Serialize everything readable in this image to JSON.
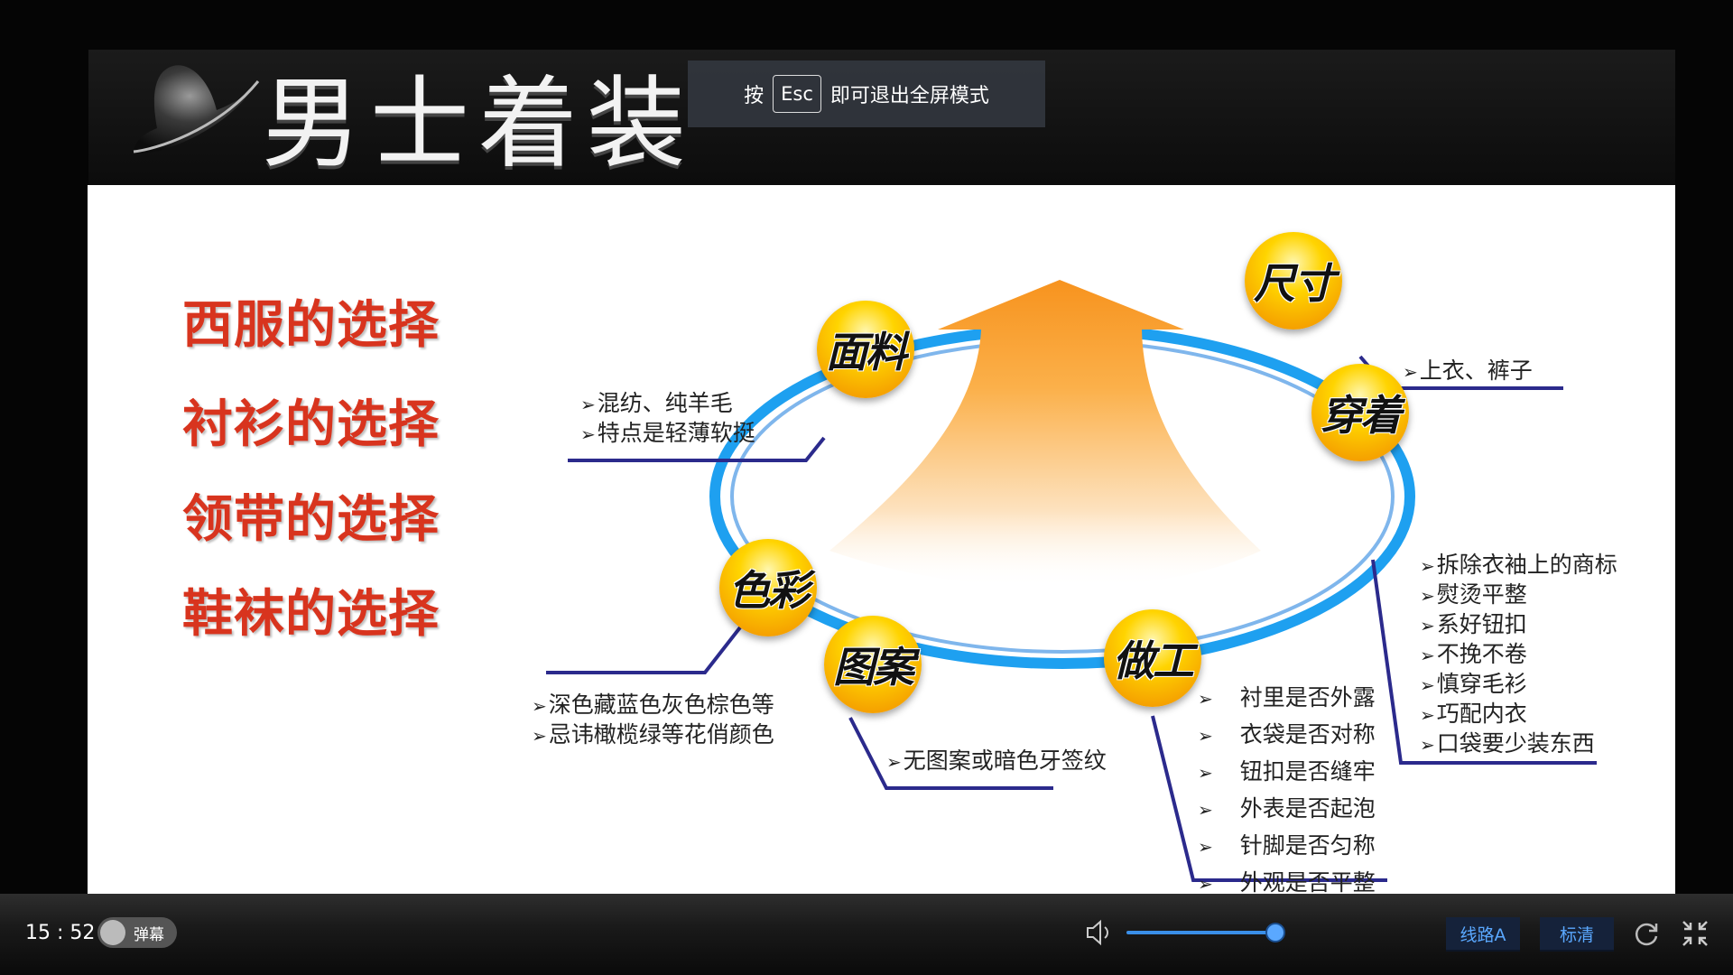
{
  "slide": {
    "title": "男士着装",
    "menu": [
      "西服的选择",
      "衬衫的选择",
      "领带的选择",
      "鞋袜的选择"
    ],
    "nodes": {
      "size": "尺寸",
      "fabric": "面料",
      "wear": "穿着",
      "color": "色彩",
      "pattern": "图案",
      "craft": "做工"
    },
    "notes": {
      "size": [
        "上衣、裤子"
      ],
      "fabric": [
        "混纺、纯羊毛",
        "特点是轻薄软挺"
      ],
      "wear": [
        "拆除衣袖上的商标",
        "熨烫平整",
        "系好钮扣",
        "不挽不卷",
        "慎穿毛衫",
        "巧配内衣",
        "口袋要少装东西"
      ],
      "color": [
        "深色藏蓝色灰色棕色等",
        "忌讳橄榄绿等花俏颜色"
      ],
      "pattern": [
        "无图案或暗色牙签纹"
      ],
      "craft": [
        "衬里是否外露",
        "衣袋是否对称",
        "钮扣是否缝牢",
        "外表是否起泡",
        "针脚是否匀称",
        "外观是否平整"
      ]
    }
  },
  "overlay": {
    "prefix": "按",
    "key": "Esc",
    "suffix": "即可退出全屏模式"
  },
  "player": {
    "time": "15 : 52",
    "danmaku_label": "弹幕",
    "volume_percent": 88,
    "line_button": "线路A",
    "quality_button": "标清"
  },
  "colors": {
    "menu_red": "#d8341e",
    "ring_blue": "#1ea0f0",
    "line_navy": "#2b2a8c",
    "arrow_orange": "#f7931e",
    "player_accent": "#5aa8ff"
  }
}
